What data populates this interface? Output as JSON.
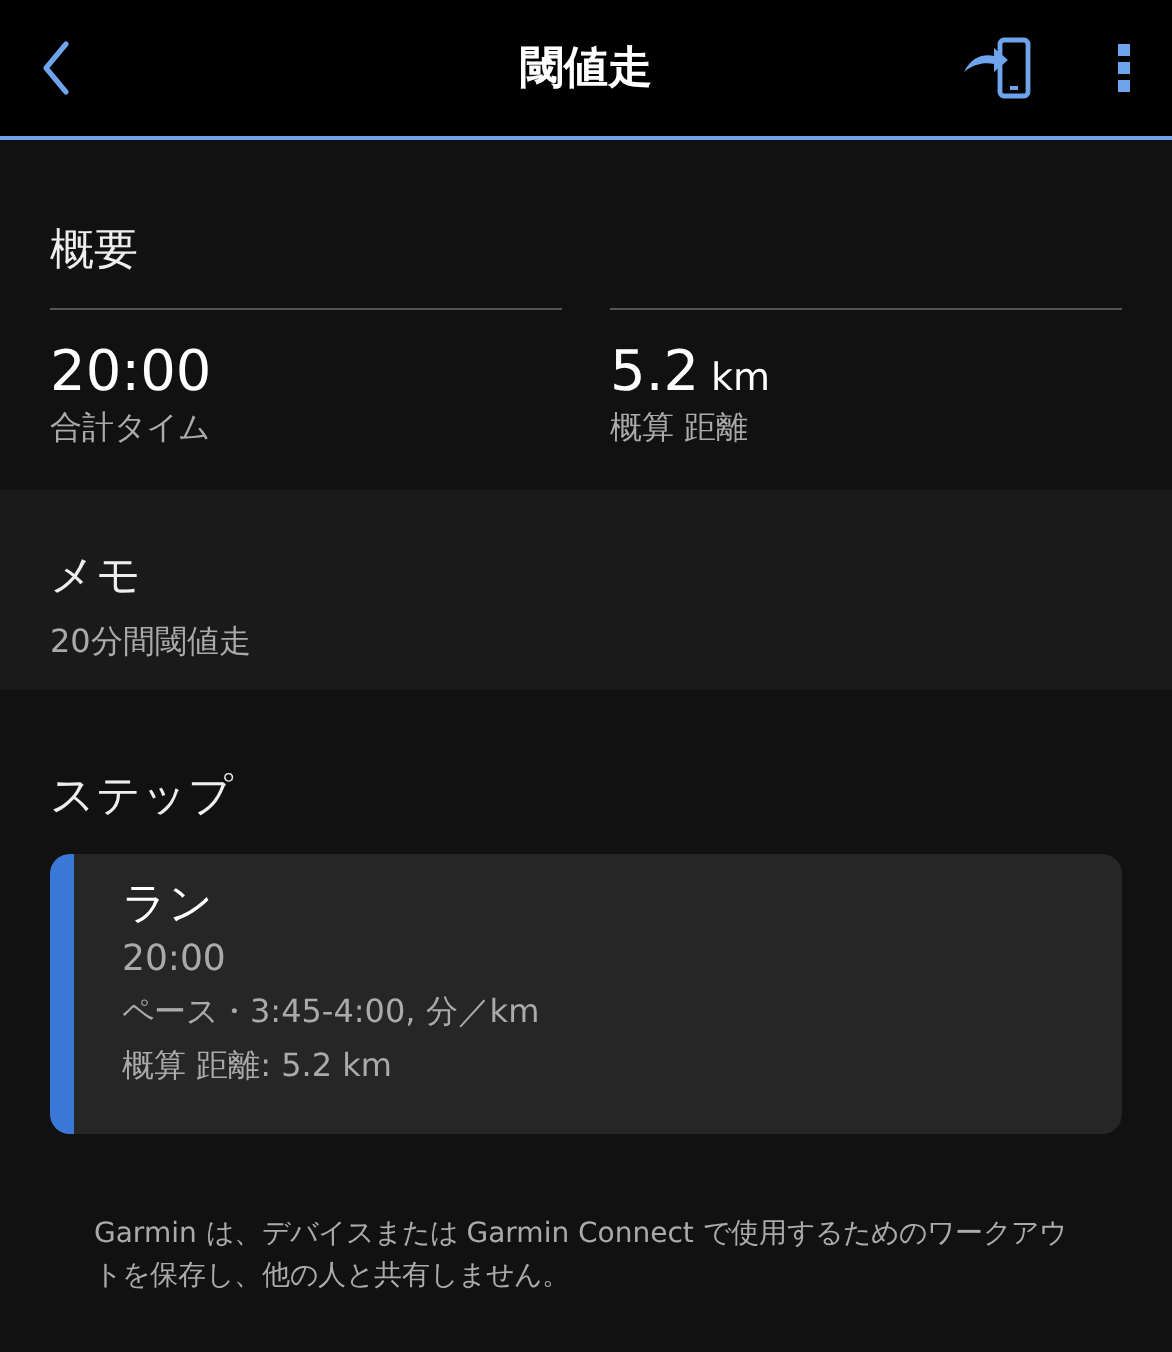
{
  "header": {
    "title": "閾値走"
  },
  "summary": {
    "heading": "概要",
    "stats": [
      {
        "value": "20:00",
        "label": "合計タイム"
      },
      {
        "value": "5.2",
        "unit": "km",
        "label": "概算 距離"
      }
    ]
  },
  "memo": {
    "heading": "メモ",
    "text": "20分間閾値走"
  },
  "steps": {
    "heading": "ステップ",
    "items": [
      {
        "name": "ラン",
        "duration": "20:00",
        "target": "ペース・3:45-4:00, 分／km",
        "distance": "概算 距離: 5.2 km",
        "color": "#3a78d8"
      }
    ]
  },
  "footer": "Garmin は、デバイスまたは Garmin Connect で使用するためのワークアウトを保存し、他の人と共有しません。"
}
